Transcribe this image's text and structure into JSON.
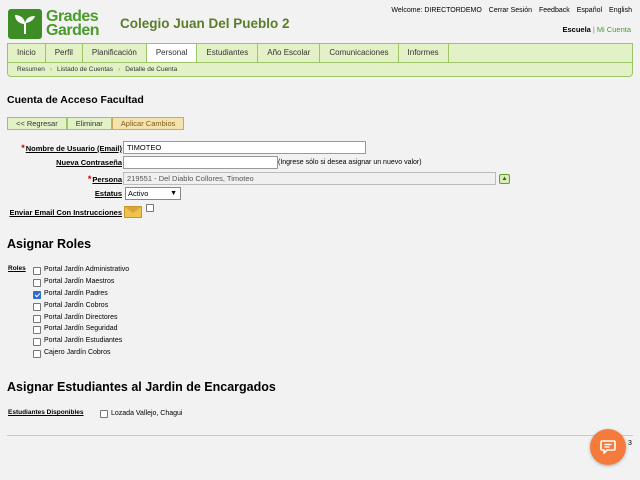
{
  "brand": {
    "line1": "Grades",
    "line2": "Garden",
    "color": "#4a9a2d"
  },
  "header": {
    "school_name": "Colegio Juan Del Pueblo 2",
    "welcome": "Welcome: DIRECTORDEMO",
    "links": [
      "Cerrar Sesión",
      "Feedback",
      "Español",
      "English"
    ],
    "scope_active": "Escuela",
    "scope_other": "Mi Cuenta"
  },
  "nav": {
    "tabs": [
      "Inicio",
      "Perfil",
      "Planificación",
      "Personal",
      "Estudiantes",
      "Año Escolar",
      "Comunicaciones",
      "Informes"
    ],
    "active_tab": "Personal"
  },
  "breadcrumb": [
    "Resumen",
    "Listado de Cuentas",
    "Detalle de Cuenta"
  ],
  "page_title": "Cuenta de Acceso Facultad",
  "buttons": {
    "back": "<< Regresar",
    "delete": "Eliminar",
    "apply": "Aplicar Cambios"
  },
  "form": {
    "username_label": "Nombre de Usuario (Email)",
    "username_value": "TIMOTEO",
    "password_label": "Nueva Contraseña",
    "password_value": "",
    "password_hint": "(Ingrese sólo si desea asignar un nuevo valor)",
    "person_label": "Persona",
    "person_value": "219551 - Del Diablo Collores, Timoteo",
    "status_label": "Estatus",
    "status_value": "Activo",
    "email_label": "Enviar Email Con Instrucciones",
    "email_checked": false
  },
  "roles_section": {
    "heading": "Asignar Roles",
    "label": "Roles",
    "items": [
      {
        "label": "Portal Jardín Administrativo",
        "checked": false
      },
      {
        "label": "Portal Jardín Maestros",
        "checked": false
      },
      {
        "label": "Portal Jardín Padres",
        "checked": true
      },
      {
        "label": "Portal Jardín Cobros",
        "checked": false
      },
      {
        "label": "Portal Jardín Directores",
        "checked": false
      },
      {
        "label": "Portal Jardín Seguridad",
        "checked": false
      },
      {
        "label": "Portal Jardín Estudiantes",
        "checked": false
      },
      {
        "label": "Cajero Jardín Cobros",
        "checked": false
      }
    ]
  },
  "students_section": {
    "heading": "Asignar Estudiantes al Jardin de Encargados",
    "label": "Estudiantes Disponibles",
    "items": [
      {
        "label": "Lozada Vallejo, Chagui",
        "checked": false
      }
    ]
  },
  "page_number": "3",
  "colors": {
    "nav_bg": "#e3f1c7",
    "nav_border": "#9cc568",
    "accent_orange": "#f47b3c",
    "required": "#cc0000"
  }
}
